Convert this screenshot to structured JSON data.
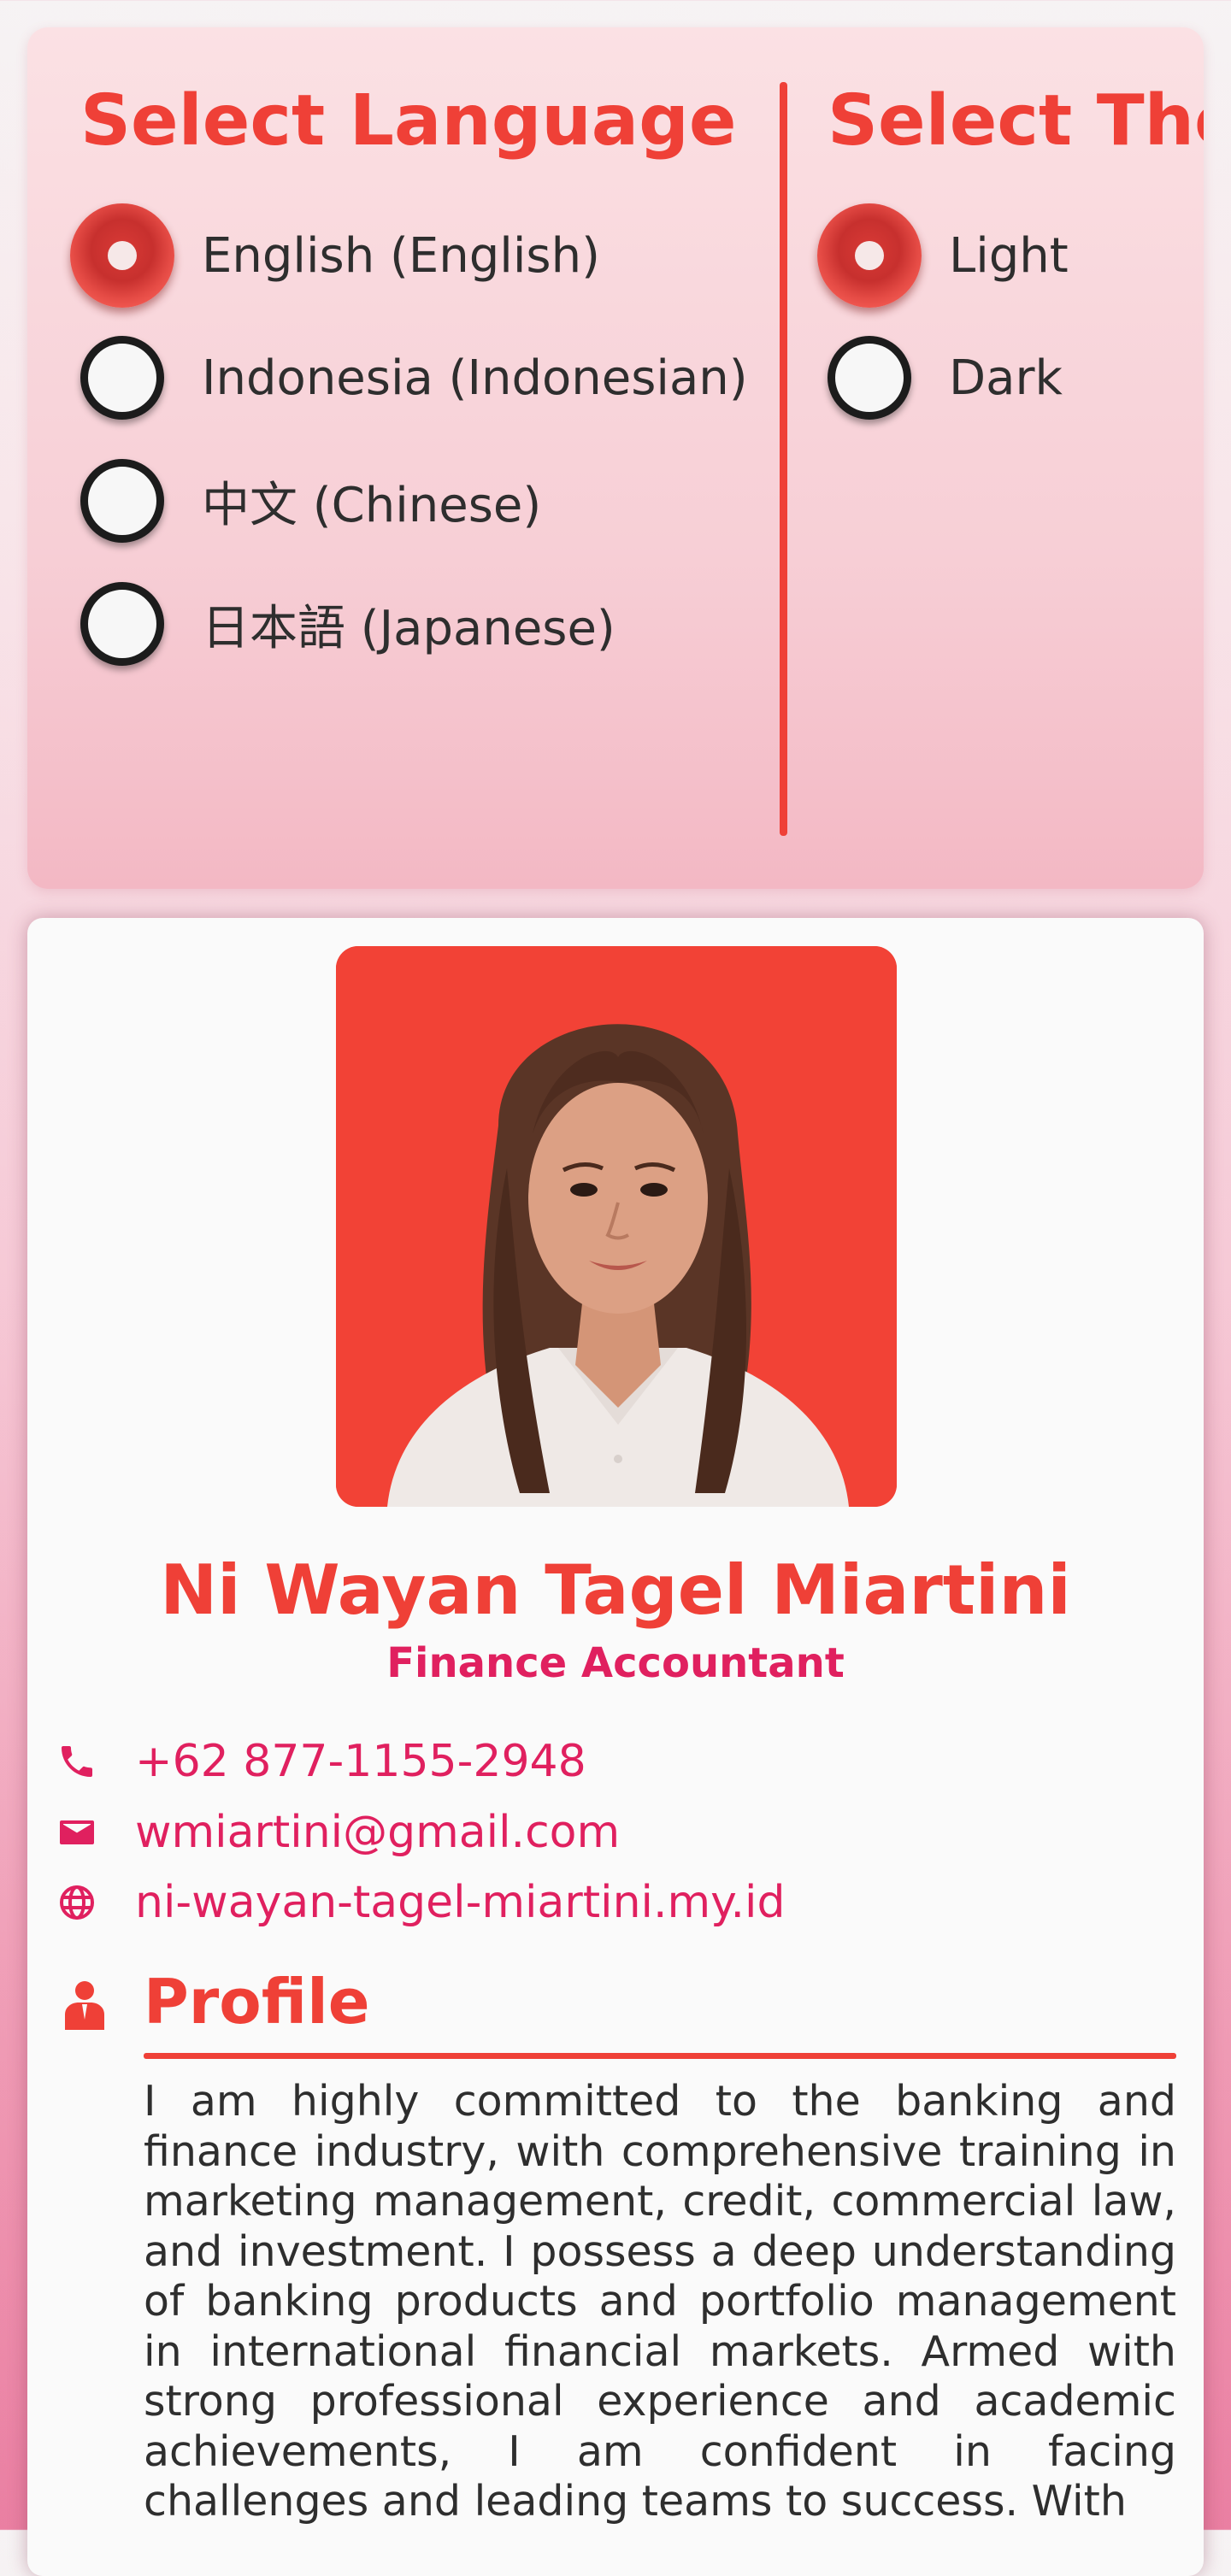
{
  "settings": {
    "language": {
      "title": "Select Language",
      "options": [
        {
          "label": "English (English)",
          "selected": true
        },
        {
          "label": "Indonesia (Indonesian)",
          "selected": false
        },
        {
          "label": "中文 (Chinese)",
          "selected": false
        },
        {
          "label": "日本語 (Japanese)",
          "selected": false
        }
      ]
    },
    "theme": {
      "title": "Select Theme",
      "options": [
        {
          "label": "Light",
          "selected": true
        },
        {
          "label": "Dark",
          "selected": false
        }
      ]
    },
    "scroll_progress": 0.49
  },
  "profile": {
    "name": "Ni Wayan Tagel Miartini",
    "job_title": "Finance Accountant",
    "contacts": {
      "phone": {
        "icon": "phone-icon",
        "text": "+62 877-1155-2948"
      },
      "email": {
        "icon": "email-icon",
        "text": "wmiartini@gmail.com"
      },
      "website": {
        "icon": "globe-icon",
        "text": "ni-wayan-tagel-miartini.my.id"
      }
    },
    "section": {
      "icon": "person-icon",
      "title": "Profile",
      "text": "I am highly committed to the banking and finance industry, with comprehensive training in marketing management, credit, commercial law, and investment. I possess a deep understanding of banking products and portfolio management in international financial markets. Armed with strong professional experience and academic achievements, I am confident in facing challenges and leading teams to success. With"
    }
  },
  "colors": {
    "accent": "#ef4037",
    "link": "#e0205f",
    "text": "#2e2e2e",
    "card": "#fafafa"
  }
}
